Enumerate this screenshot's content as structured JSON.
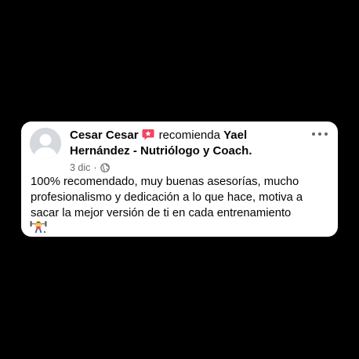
{
  "post": {
    "author": "Cesar Cesar",
    "action": "recomienda",
    "page_name": "Yael Hernández - Nutriólogo y Coach.",
    "timestamp": "3 dic",
    "separator": "·",
    "audience_icon": "globe-icon",
    "recommend_icon": "recommend-star-icon",
    "more_icon": "more-options-icon",
    "text": "100% recomendado, muy buenas asesorías, mucho profesionalismo y dedicación a lo que hace, motiva a sacar la mejor versión de ti en cada entrenamiento",
    "emoji_icon": "weightlifter-emoji-icon"
  },
  "colors": {
    "background": "#000000",
    "card": "#ffffff",
    "recommend_badge": "#f3425f",
    "secondary_text": "#65676b",
    "avatar_bg": "#d5d8dc"
  }
}
